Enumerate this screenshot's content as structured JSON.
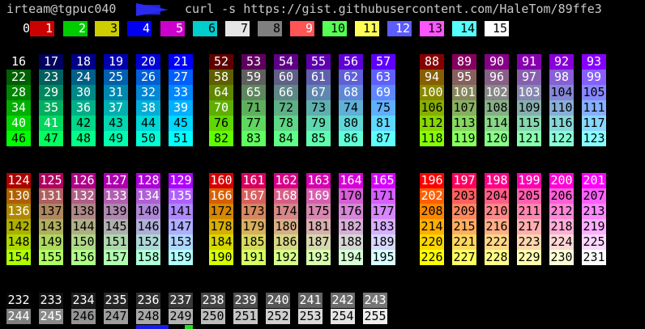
{
  "prompt": {
    "user_host": "irteam@tgpuc040",
    "command": "curl -s https://gist.githubusercontent.com/HaleTom/89ffe3"
  },
  "palette": {
    "basic": [
      "#000000",
      "#cd0000",
      "#00cd00",
      "#cdcd00",
      "#0000ee",
      "#cd00cd",
      "#00cdcd",
      "#e5e5e5",
      "#7f7f7f",
      "#ff5555",
      "#55ff55",
      "#ffff55",
      "#5c5cff",
      "#ff55ff",
      "#55ffff",
      "#ffffff"
    ],
    "cube_levels": [
      0,
      95,
      135,
      175,
      215,
      255
    ],
    "gray_range": [
      8,
      10
    ]
  },
  "labels": {
    "basic_row": [
      "0",
      "1",
      "2",
      "3",
      "4",
      "5",
      "6",
      "7",
      "8",
      "9",
      "10",
      "11",
      "12",
      "13",
      "14",
      "15"
    ],
    "gray_row1": [
      "232",
      "233",
      "234",
      "235",
      "236",
      "237",
      "238",
      "239",
      "240",
      "241",
      "242",
      "243"
    ],
    "gray_row2": [
      "244",
      "245",
      "246",
      "247",
      "248",
      "249",
      "250",
      "251",
      "252",
      "253",
      "254",
      "255"
    ]
  }
}
